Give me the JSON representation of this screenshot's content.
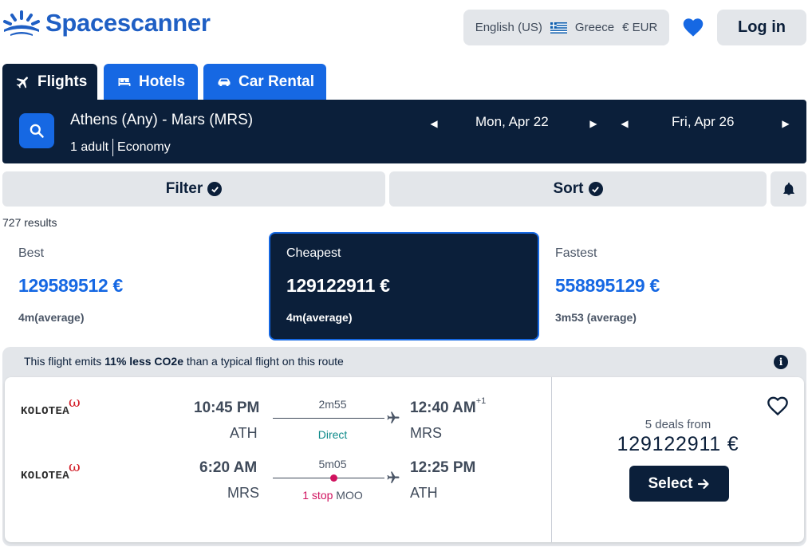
{
  "header": {
    "brand": "Spacescanner",
    "locale": {
      "language": "English (US)",
      "country": "Greece",
      "currency": "€ EUR"
    },
    "login_label": "Log in",
    "icons": {
      "logo": "sunrise-logo-icon",
      "favorites": "heart-icon",
      "flag": "greece-flag-icon"
    }
  },
  "tabs": [
    {
      "label": "Flights",
      "icon": "plane-icon",
      "active": true
    },
    {
      "label": "Hotels",
      "icon": "bed-icon",
      "active": false
    },
    {
      "label": "Car Rental",
      "icon": "car-icon",
      "active": false
    }
  ],
  "search": {
    "route": "Athens (Any) - Mars (MRS)",
    "passengers": "1 adult",
    "cabin": "Economy",
    "depart_date": "Mon, Apr 22",
    "return_date": "Fri, Apr 26"
  },
  "toolbar": {
    "filter_label": "Filter",
    "sort_label": "Sort",
    "alert_icon": "bell-icon"
  },
  "results": {
    "count_text": "727 results"
  },
  "sort_options": [
    {
      "label": "Best",
      "price": "129589512 €",
      "duration": "4m(average)",
      "selected": false
    },
    {
      "label": "Cheapest",
      "price": "129122911 €",
      "duration": "4m(average)",
      "selected": true
    },
    {
      "label": "Fastest",
      "price": "558895129 €",
      "duration": "3m53 (average)",
      "selected": false
    }
  ],
  "flight": {
    "eco": {
      "prefix": "This flight emits ",
      "highlight": "11% less CO2e",
      "suffix": " than a typical flight on this route"
    },
    "outbound": {
      "airline": "KOLOTEA",
      "dep_time": "10:45 PM",
      "dep_code": "ATH",
      "duration": "2m55",
      "stops": "Direct",
      "arr_time": "12:40 AM",
      "arr_offset": "+1",
      "arr_code": "MRS"
    },
    "inbound": {
      "airline": "KOLOTEA",
      "dep_time": "6:20 AM",
      "dep_code": "MRS",
      "duration": "5m05",
      "stops": "1 stop",
      "via": "MOO",
      "arr_time": "12:25 PM",
      "arr_code": "ATH"
    },
    "deals_text": "5 deals from",
    "price": "129122911 €",
    "select_label": "Select"
  },
  "colors": {
    "navy": "#0b1f3a",
    "blue": "#1668e3",
    "grey": "#e3e6ea",
    "stop": "#d0125e",
    "direct": "#0e8a8a",
    "brand_red": "#d21a24"
  }
}
